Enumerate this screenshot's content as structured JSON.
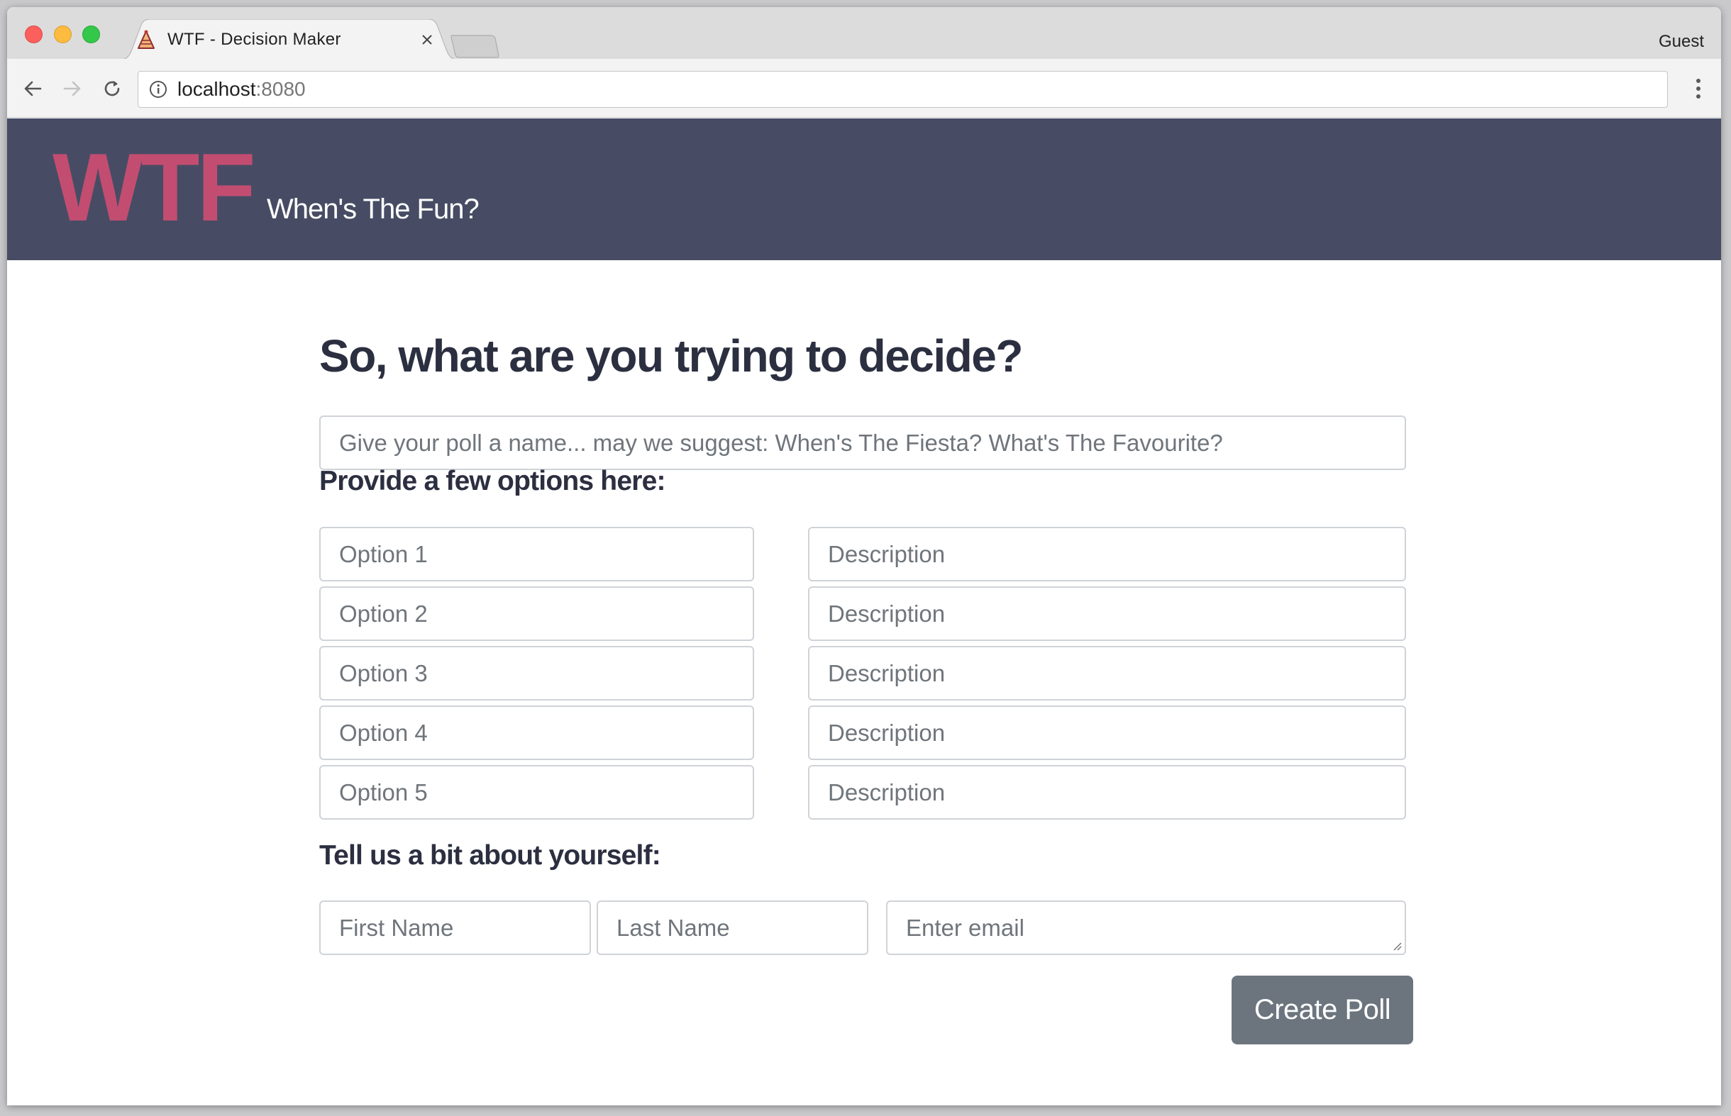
{
  "browser": {
    "tab_title": "WTF - Decision Maker",
    "profile_label": "Guest",
    "url_host": "localhost",
    "url_port": ":8080"
  },
  "header": {
    "logo": "WTF",
    "tagline": "When's The Fun?",
    "background_color": "#474c64",
    "logo_color": "#c24d71"
  },
  "form": {
    "heading": "So, what are you trying to decide?",
    "poll_name_placeholder": "Give your poll a name... may we suggest: When's The Fiesta? What's The Favourite?",
    "options_heading": "Provide a few options here:",
    "options": [
      {
        "option_placeholder": "Option 1",
        "description_placeholder": "Description"
      },
      {
        "option_placeholder": "Option 2",
        "description_placeholder": "Description"
      },
      {
        "option_placeholder": "Option 3",
        "description_placeholder": "Description"
      },
      {
        "option_placeholder": "Option 4",
        "description_placeholder": "Description"
      },
      {
        "option_placeholder": "Option 5",
        "description_placeholder": "Description"
      }
    ],
    "about_heading": "Tell us a bit about yourself:",
    "first_name_placeholder": "First Name",
    "last_name_placeholder": "Last Name",
    "email_placeholder": "Enter email",
    "submit_label": "Create Poll",
    "submit_color": "#6c757e"
  }
}
